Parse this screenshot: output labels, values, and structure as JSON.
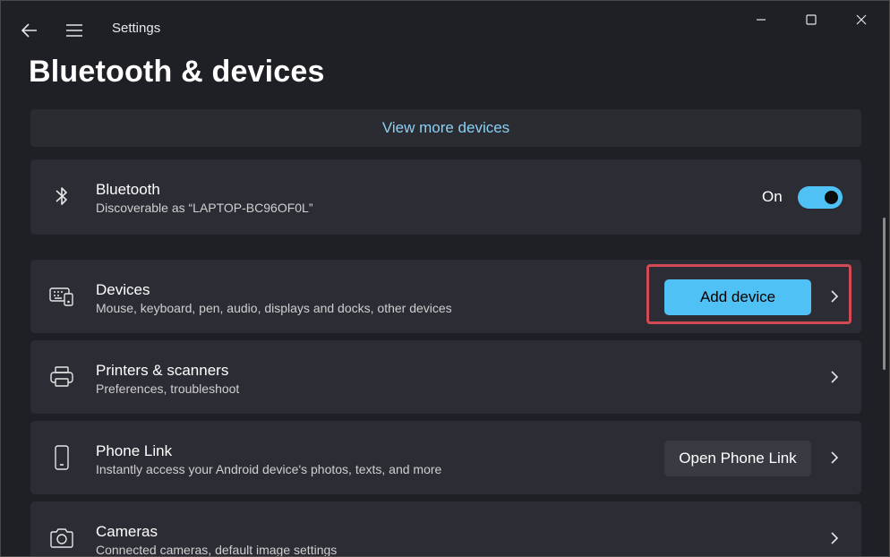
{
  "window": {
    "app_title": "Settings"
  },
  "page": {
    "title": "Bluetooth & devices"
  },
  "view_more": {
    "label": "View more devices"
  },
  "bluetooth": {
    "title": "Bluetooth",
    "subtitle": "Discoverable as “LAPTOP-BC96OF0L”",
    "toggle_label": "On",
    "toggle_on": true
  },
  "devices": {
    "title": "Devices",
    "subtitle": "Mouse, keyboard, pen, audio, displays and docks, other devices",
    "button_label": "Add device"
  },
  "printers": {
    "title": "Printers & scanners",
    "subtitle": "Preferences, troubleshoot"
  },
  "phone": {
    "title": "Phone Link",
    "subtitle": "Instantly access your Android device's photos, texts, and more",
    "button_label": "Open Phone Link"
  },
  "cameras": {
    "title": "Cameras",
    "subtitle": "Connected cameras, default image settings"
  },
  "colors": {
    "accent": "#4fc1f5",
    "link": "#8bd0f5",
    "highlight": "#d24a55",
    "card": "#2c2d34",
    "background": "#1f2026"
  },
  "icons": {
    "back": "back-arrow-icon",
    "menu": "hamburger-menu-icon",
    "minimize": "minimize-icon",
    "maximize": "maximize-icon",
    "close": "close-icon",
    "bluetooth": "bluetooth-icon",
    "devices": "keyboard-devices-icon",
    "printers": "printer-icon",
    "phone": "phone-icon",
    "cameras": "camera-icon",
    "chevron": "chevron-right-icon"
  }
}
